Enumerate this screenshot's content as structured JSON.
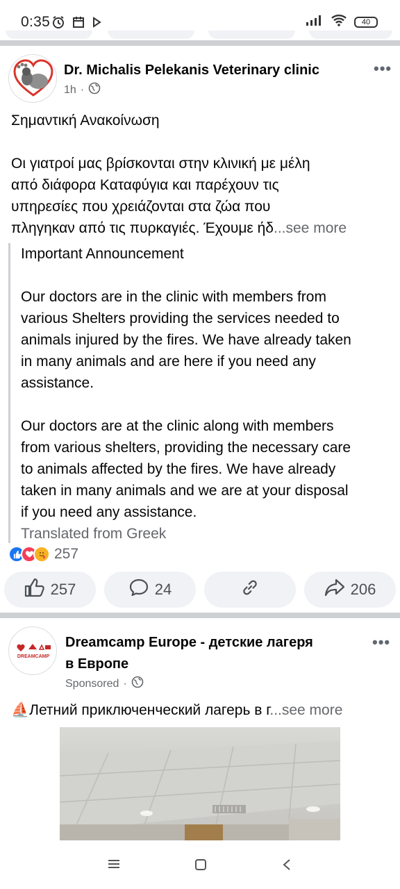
{
  "status_bar": {
    "time": "0:35",
    "battery": "40",
    "icons": [
      "alarm-icon",
      "calendar-icon",
      "play-icon",
      "signal-icon",
      "wifi-icon",
      "battery-icon"
    ]
  },
  "post1": {
    "author": "Dr. Michalis Pelekanis Veterinary clinic",
    "time": "1h",
    "privacy_icon": "globe-icon",
    "text_lines": [
      "Σημαντική Ανακοίνωση",
      "",
      "Οι γιατροί μας βρίσκονται στην κλινική με  μέλη",
      "από διάφορα Καταφύγια και παρέχουν τις",
      "υπηρεσίες που χρειάζονται  στα ζώα που",
      "πληγηκαν από τις πυρκαγιές. Έχουμε ήδ"
    ],
    "see_more": "...see more",
    "translation_lines": [
      "Important Announcement",
      "",
      "Our doctors are in the clinic with members from",
      "various Shelters providing the services needed to",
      "animals injured by the fires. We have already taken",
      "in many animals and are here if you need any",
      "assistance.",
      "",
      "Our doctors  are at the clinic along with members",
      "from various shelters, providing the necessary care",
      "to animals affected by the fires. We have already",
      "taken in many animals and we are at your disposal",
      "if you need any assistance."
    ],
    "translated_from": "Translated from Greek",
    "reactions": {
      "count": "257",
      "types": [
        "like",
        "love",
        "care"
      ],
      "colors": {
        "like": "#1877f2",
        "love": "#f33e58",
        "care": "#f7b125"
      }
    },
    "actions": {
      "like_count": "257",
      "comment_count": "24",
      "share_count": "206"
    }
  },
  "post2": {
    "author_line1": "Dreamcamp Europe - детские лагеря",
    "author_line2": "в Европе",
    "meta": "Sponsored",
    "logo_text": "DREAMCAMP",
    "emoji": "⛵",
    "text": "Летний приключенческий лагерь в г",
    "see_more": "...see more"
  },
  "colors": {
    "divider": "#ced0d4",
    "secondary_text": "#65676b",
    "button_bg": "#f0f2f5"
  }
}
